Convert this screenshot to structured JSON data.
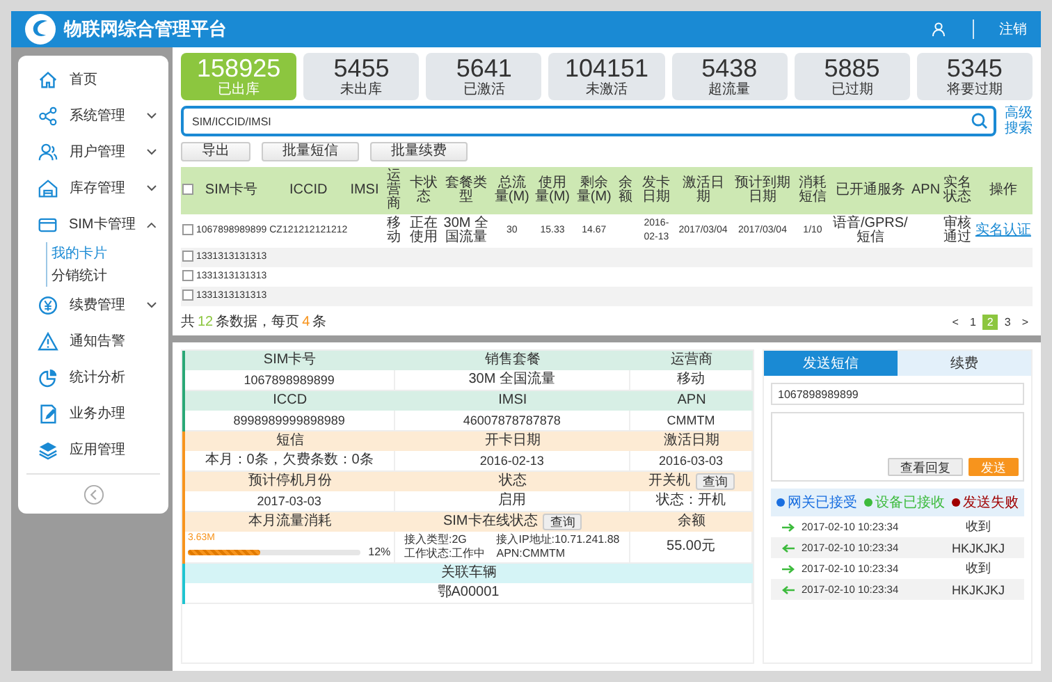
{
  "header": {
    "title": "物联网综合管理平台",
    "logout": "注销"
  },
  "sidebar": {
    "items": [
      {
        "label": "首页",
        "selected": false
      },
      {
        "label": "系统管理",
        "selected": false,
        "expanded": false
      },
      {
        "label": "用户管理",
        "selected": false,
        "expanded": false
      },
      {
        "label": "库存管理",
        "selected": false,
        "expanded": false
      },
      {
        "label": "SIM卡管理",
        "selected": false,
        "expanded": true,
        "children": [
          {
            "label": "我的卡片",
            "selected": true
          },
          {
            "label": "分销统计",
            "selected": false
          }
        ]
      },
      {
        "label": "续费管理",
        "selected": false,
        "expanded": false
      },
      {
        "label": "通知告警",
        "selected": false
      },
      {
        "label": "统计分析",
        "selected": false
      },
      {
        "label": "业务办理",
        "selected": false
      },
      {
        "label": "应用管理",
        "selected": false
      }
    ]
  },
  "stats": [
    {
      "value": "158925",
      "label": "已出库",
      "selected": true
    },
    {
      "value": "5455",
      "label": "未出库",
      "selected": false
    },
    {
      "value": "5641",
      "label": "已激活",
      "selected": false
    },
    {
      "value": "104151",
      "label": "未激活",
      "selected": false
    },
    {
      "value": "5438",
      "label": "超流量",
      "selected": false
    },
    {
      "value": "5885",
      "label": "已过期",
      "selected": false
    },
    {
      "value": "5345",
      "label": "将要过期",
      "selected": false
    }
  ],
  "search": {
    "placeholder": "SIM/ICCID/IMSI",
    "advanced": "高级搜索"
  },
  "actions": [
    "导出",
    "批量短信",
    "批量续费"
  ],
  "table": {
    "select_all": false,
    "columns": [
      "SIM卡号",
      "ICCID",
      "IMSI",
      "运营商",
      "卡状态",
      "套餐类型",
      "总流量(M)",
      "使用量(M)",
      "剩余量(M)",
      "余额",
      "发卡日期",
      "激活日期",
      "预计到期日期",
      "消耗短信",
      "已开通服务",
      "APN",
      "实名状态",
      "操作"
    ],
    "rows": [
      {
        "checked": false,
        "cells": [
          "1067898989899",
          "CZ121212121212",
          null,
          "移动",
          "正在使用",
          "30M 全国流量",
          "30",
          "15.33",
          "14.67",
          null,
          "2016-02-13",
          "2017/03/04",
          "2017/03/04",
          "1/10",
          "语音/GPRS/短信",
          null,
          "审核通过"
        ],
        "action": "实名认证"
      },
      {
        "checked": false,
        "cells": [
          "1331313131313"
        ]
      },
      {
        "checked": false,
        "cells": [
          "1331313131313"
        ]
      },
      {
        "checked": false,
        "cells": [
          "1331313131313"
        ]
      }
    ]
  },
  "pager": {
    "parts": [
      "共",
      "12",
      "条数据，每页",
      "4",
      "条"
    ],
    "prev": "<",
    "next": ">",
    "pages": [
      {
        "label": "1",
        "selected": false
      },
      {
        "label": "2",
        "selected": true
      },
      {
        "label": "3",
        "selected": false
      }
    ]
  },
  "detail": {
    "sections": [
      {
        "color": "#2aa876",
        "rows": [
          {
            "headers": [
              {
                "text": "SIM卡号"
              },
              {
                "text": "销售套餐"
              },
              {
                "text": "运营商"
              }
            ],
            "values": [
              {
                "kind": "text",
                "text": "1067898989899"
              },
              {
                "kind": "text",
                "text": "30M 全国流量"
              },
              {
                "kind": "text",
                "text": "移动"
              }
            ]
          },
          {
            "headers": [
              {
                "text": "ICCD"
              },
              {
                "text": "IMSI"
              },
              {
                "text": "APN"
              }
            ],
            "values": [
              {
                "kind": "text",
                "text": "8998989999898989"
              },
              {
                "kind": "text",
                "text": "46007878787878"
              },
              {
                "kind": "text",
                "text": "CMMTM"
              }
            ]
          }
        ]
      },
      {
        "color": "#f7941d",
        "rows": [
          {
            "headers": [
              {
                "text": "短信"
              },
              {
                "text": "开卡日期"
              },
              {
                "text": "激活日期"
              }
            ],
            "values": [
              {
                "kind": "text",
                "text": "本月：0条，欠费条数：0条"
              },
              {
                "kind": "text",
                "text": "2016-02-13"
              },
              {
                "kind": "text",
                "text": "2016-03-03"
              }
            ]
          },
          {
            "headers": [
              {
                "text": "预计停机月份"
              },
              {
                "text": "状态"
              },
              {
                "text": "开关机",
                "button": "查询"
              }
            ],
            "values": [
              {
                "kind": "text",
                "text": "2017-03-03"
              },
              {
                "kind": "text",
                "text": "启用"
              },
              {
                "kind": "text",
                "text": "状态：开机"
              }
            ]
          },
          {
            "headers": [
              {
                "text": "本月流量消耗"
              },
              {
                "text": "SIM卡在线状态",
                "button": "查询"
              },
              {
                "text": "余额"
              }
            ],
            "values": [
              {
                "kind": "usage",
                "reading": "3.63M",
                "level": 0.42,
                "percent": "12%"
              },
              {
                "kind": "access",
                "lines": [
                  "接入类型:2G",
                  "接入IP地址:10.71.241.88",
                  "工作状态:工作中",
                  "APN:CMMTM"
                ]
              },
              {
                "kind": "text",
                "text": "55.00元"
              }
            ]
          }
        ]
      },
      {
        "color": "#1fc4d0",
        "rows": [
          {
            "headers": [
              {
                "text": "关联车辆"
              }
            ],
            "values": [
              {
                "kind": "text",
                "text": "鄂A00001"
              }
            ]
          }
        ]
      }
    ]
  },
  "sms": {
    "tabs": [
      {
        "label": "发送短信",
        "selected": true
      },
      {
        "label": "续费",
        "selected": false
      }
    ],
    "recipient": "1067898989899",
    "buttons": [
      {
        "label": "查看回复",
        "kind": "secondary"
      },
      {
        "label": "发送",
        "kind": "primary"
      }
    ],
    "legend": [
      {
        "label": "网关已接受",
        "color": "#1a6fe0"
      },
      {
        "label": "设备已接收",
        "color": "#3dbb3d"
      },
      {
        "label": "发送失败",
        "color": "#a00000"
      }
    ],
    "messages": [
      {
        "kind": "outgoing",
        "time": "2017-02-10 10:23:34",
        "text": "收到"
      },
      {
        "kind": "incoming",
        "time": "2017-02-10 10:23:34",
        "text": "HKJKJKJ"
      },
      {
        "kind": "outgoing",
        "time": "2017-02-10 10:23:34",
        "text": "收到"
      },
      {
        "kind": "incoming",
        "time": "2017-02-10 10:23:34",
        "text": "HKJKJKJ"
      }
    ]
  }
}
